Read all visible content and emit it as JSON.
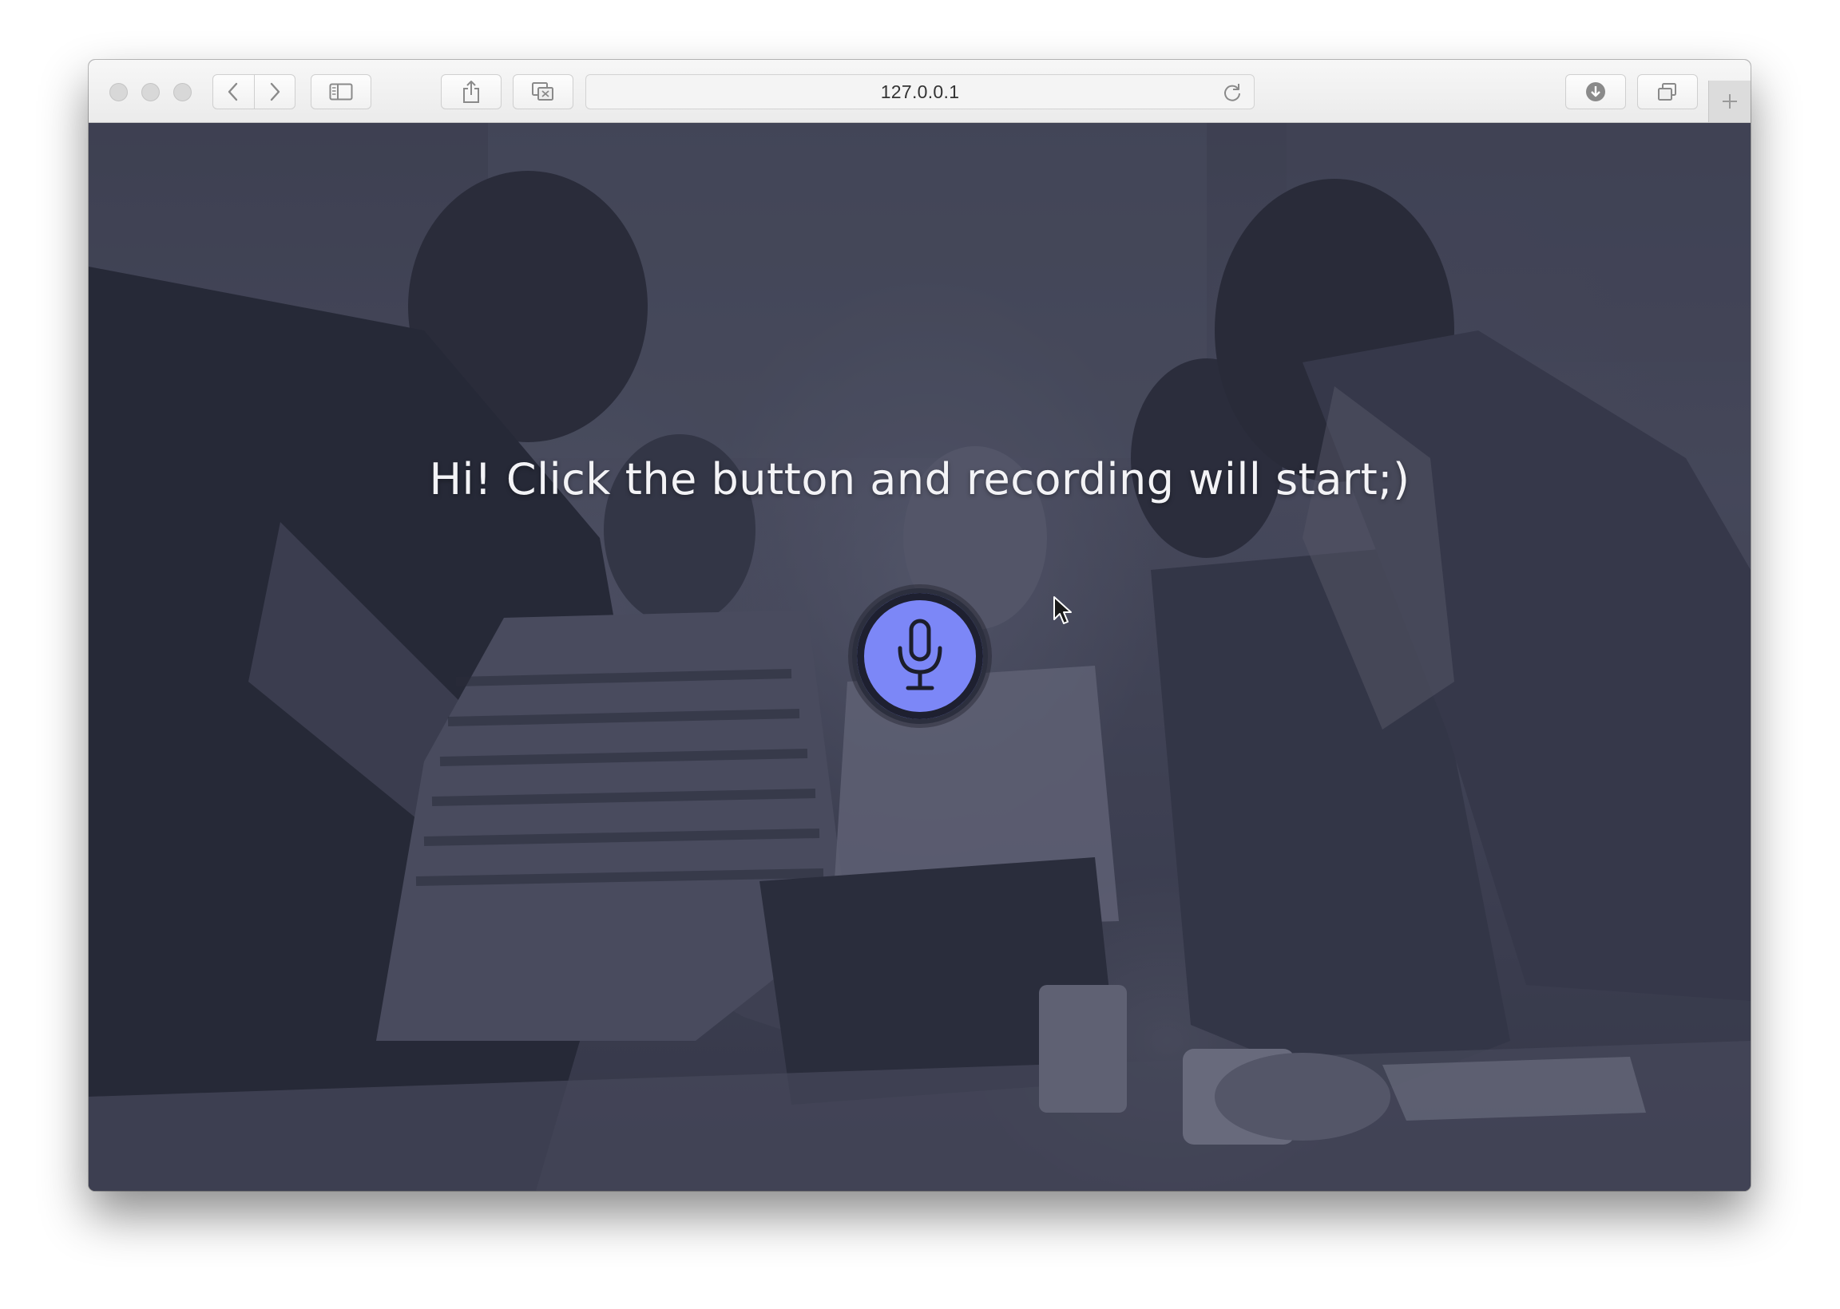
{
  "browser": {
    "url": "127.0.0.1",
    "icons": {
      "close": "close-traffic-light",
      "minimize": "minimize-traffic-light",
      "zoom": "zoom-traffic-light",
      "back": "chevron-left-icon",
      "forward": "chevron-right-icon",
      "sidebar": "sidebar-icon",
      "share": "share-icon",
      "tab_action": "tab-action-icon",
      "reload": "reload-icon",
      "downloads": "download-icon",
      "tabs": "show-tabs-icon",
      "new_tab": "plus-icon"
    }
  },
  "page": {
    "headline": "Hi! Click the button and recording will start;)",
    "record_button_icon": "microphone-icon",
    "colors": {
      "accent": "#7c87f7",
      "button_border": "#2c2f3e",
      "text": "#f3f3f6"
    }
  }
}
